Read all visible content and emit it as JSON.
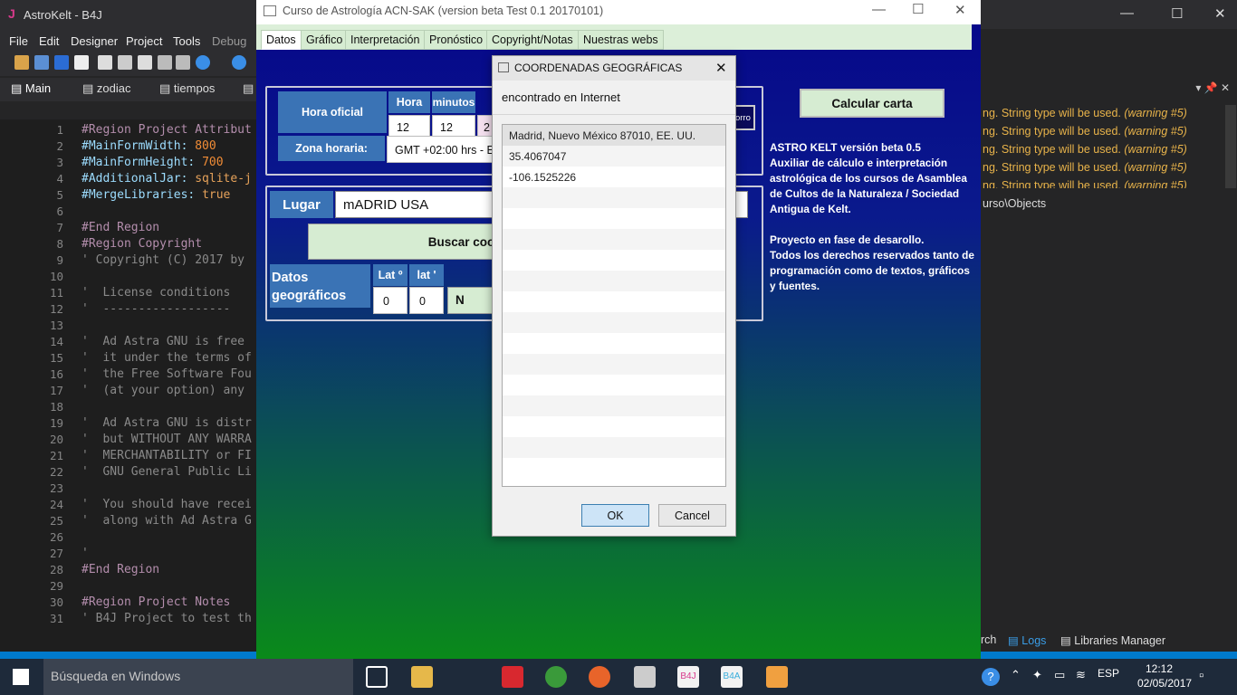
{
  "ide": {
    "title": "AstroKelt - B4J",
    "logo": "J",
    "menu": [
      "File",
      "Edit",
      "Designer",
      "Project",
      "Tools",
      "Debug"
    ],
    "tabs": [
      "Main",
      "zodiac",
      "tiempos"
    ],
    "code_lines": [
      {
        "n": "1",
        "text": "#Region Project Attribut"
      },
      {
        "n": "2",
        "key": "#MainFormWidth: ",
        "val": "800"
      },
      {
        "n": "3",
        "key": "#MainFormHeight: ",
        "val": "700"
      },
      {
        "n": "4",
        "key": "#AdditionalJar: ",
        "val": "sqlite-j"
      },
      {
        "n": "5",
        "key": "#MergeLibraries: ",
        "val": "true"
      },
      {
        "n": "6",
        "text": ""
      },
      {
        "n": "7",
        "text": "#End Region"
      },
      {
        "n": "8",
        "text": "#Region Copyright"
      },
      {
        "n": "9",
        "text": "' Copyright (C) 2017 by"
      },
      {
        "n": "10",
        "text": ""
      },
      {
        "n": "11",
        "text": "'  License conditions"
      },
      {
        "n": "12",
        "text": "'  ------------------"
      },
      {
        "n": "13",
        "text": ""
      },
      {
        "n": "14",
        "text": "'  Ad Astra GNU is free"
      },
      {
        "n": "15",
        "text": "'  it under the terms of"
      },
      {
        "n": "16",
        "text": "'  the Free Software Fou"
      },
      {
        "n": "17",
        "text": "'  (at your option) any"
      },
      {
        "n": "18",
        "text": ""
      },
      {
        "n": "19",
        "text": "'  Ad Astra GNU is distr"
      },
      {
        "n": "20",
        "text": "'  but WITHOUT ANY WARRA"
      },
      {
        "n": "21",
        "text": "'  MERCHANTABILITY or FI"
      },
      {
        "n": "22",
        "text": "'  GNU General Public Li"
      },
      {
        "n": "23",
        "text": ""
      },
      {
        "n": "24",
        "text": "'  You should have recei"
      },
      {
        "n": "25",
        "text": "'  along with Ad Astra G"
      },
      {
        "n": "26",
        "text": ""
      },
      {
        "n": "27",
        "text": "'"
      },
      {
        "n": "28",
        "text": "#End Region"
      },
      {
        "n": "29",
        "text": ""
      },
      {
        "n": "30",
        "text": "#Region Project Notes"
      },
      {
        "n": "31",
        "text": "' B4J Project to test th"
      }
    ],
    "warnings": [
      {
        "text": "ng. String type will be used. ",
        "tag": "(warning #5)"
      },
      {
        "text": "ng. String type will be used. ",
        "tag": "(warning #5)"
      },
      {
        "text": "ng. String type will be used. ",
        "tag": "(warning #5)"
      },
      {
        "text": "ng. String type will be used. ",
        "tag": "(warning #5)"
      },
      {
        "text": "ng. String type will be used. ",
        "tag": "(warning #5)"
      }
    ],
    "objects_path": "urso\\Objects",
    "bottom_tabs": [
      "rch",
      "Logs",
      "Libraries Manager"
    ]
  },
  "app": {
    "title": "Curso de Astrología ACN-SAK (version beta Test 0.1 20170101)",
    "tabs": [
      "Datos",
      "Gráfico",
      "Interpretación",
      "Pronóstico",
      "Copyright/Notas",
      "Nuestras webs"
    ],
    "hora_oficial": "Hora oficial",
    "hora_label": "Hora",
    "minutos_label": "minutos",
    "hora_value": "12",
    "minutos_value": "12",
    "hidden_value": "2",
    "zona_label": "Zona horaria:",
    "zona_value": "GMT +02:00 hrs - E",
    "borro_label": "orro",
    "lugar_label": "Lugar",
    "lugar_value": "mADRID USA",
    "buscar_label": "Buscar coorde",
    "datos_geo_label": "Datos geográficos",
    "lat_deg_label": "Lat º",
    "lat_min_label": "lat '",
    "lat_deg_value": "0",
    "lat_min_value": "0",
    "ns_value": "N",
    "calcular_label": "Calcular carta",
    "info_text": "ASTRO KELT versión beta 0.5\nAuxiliar de cálculo e interpretación astrológica de los cursos de Asamblea de Cultos de la Naturaleza / Sociedad Antigua de Kelt.\n\nProyecto en fase de desarollo.\nTodos los derechos reservados tanto de programación como de textos, gráficos y fuentes."
  },
  "dialog": {
    "title": "COORDENADAS GEOGRÁFICAS",
    "message": "encontrado en Internet",
    "rows": [
      "Madrid, Nuevo México 87010, EE. UU.",
      "35.4067047",
      "-106.1525226",
      "",
      "",
      "",
      "",
      "",
      "",
      "",
      "",
      "",
      "",
      "",
      "",
      "",
      ""
    ],
    "ok_label": "OK",
    "cancel_label": "Cancel"
  },
  "taskbar": {
    "search_placeholder": "Búsqueda en Windows",
    "lang": "ESP",
    "time": "12:12",
    "date": "02/05/2017",
    "b4j": "B4J",
    "b4a": "B4A"
  }
}
